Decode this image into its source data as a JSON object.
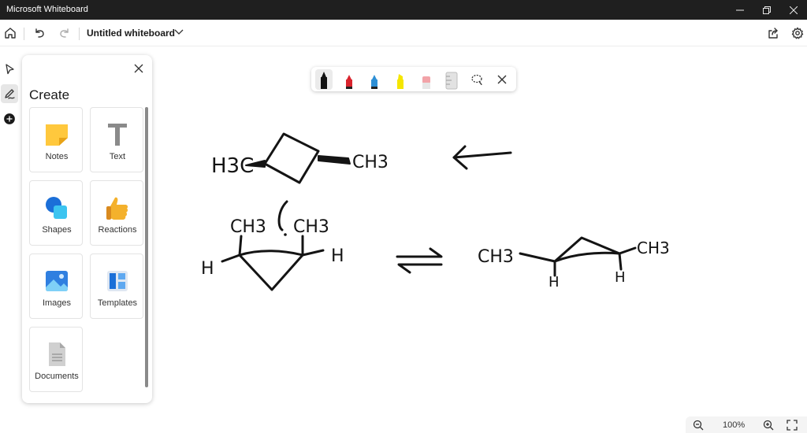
{
  "window": {
    "title": "Microsoft Whiteboard"
  },
  "header": {
    "doc_title": "Untitled whiteboard",
    "icons": [
      "home-icon",
      "undo-icon",
      "redo-icon",
      "chevron-down-icon",
      "share-icon",
      "gear-icon"
    ]
  },
  "rail": {
    "items": [
      "select-tool",
      "inking-tool",
      "create-tool"
    ]
  },
  "panel": {
    "title": "Create",
    "tiles": [
      {
        "label": "Notes",
        "icon": "sticky-note-icon"
      },
      {
        "label": "Text",
        "icon": "text-icon"
      },
      {
        "label": "Shapes",
        "icon": "shapes-icon"
      },
      {
        "label": "Reactions",
        "icon": "thumbs-up-icon"
      },
      {
        "label": "Images",
        "icon": "image-icon"
      },
      {
        "label": "Templates",
        "icon": "templates-icon"
      },
      {
        "label": "Documents",
        "icon": "document-icon"
      }
    ]
  },
  "pens": [
    {
      "name": "black-pen",
      "color": "#111111"
    },
    {
      "name": "red-pen",
      "color": "#d9232d"
    },
    {
      "name": "blue-pen",
      "color": "#2d8fd5"
    },
    {
      "name": "yellow-highlighter",
      "color": "#f5e600"
    },
    {
      "name": "eraser",
      "color": "#f2a3a8"
    },
    {
      "name": "ruler",
      "color": "#d8d8d8"
    }
  ],
  "canvas": {
    "labels": {
      "top_left": "H3C",
      "top_right": "CH3",
      "mid_left_ch": "CH3",
      "mid_right_ch": "CH3",
      "mid_left_h": "H",
      "mid_right_h": "H",
      "right_ch": "CH3",
      "right_ch2": "CH3",
      "right_h1": "H",
      "right_h2": "H"
    }
  },
  "zoom": {
    "level": "100%"
  },
  "colors": {
    "titlebar": "#1f1f1f",
    "accent_blue": "#2d8fd5"
  }
}
